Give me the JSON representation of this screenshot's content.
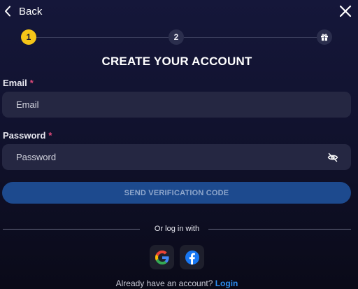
{
  "header": {
    "back_label": "Back"
  },
  "stepper": {
    "steps": [
      {
        "label": "1",
        "state": "active"
      },
      {
        "label": "2",
        "state": "inactive"
      },
      {
        "icon": "gift-icon",
        "state": "inactive"
      }
    ],
    "active_color": "#f5c518"
  },
  "form": {
    "title": "CREATE YOUR ACCOUNT",
    "email": {
      "label": "Email",
      "required_mark": "*",
      "placeholder": "Email",
      "value": ""
    },
    "password": {
      "label": "Password",
      "required_mark": "*",
      "placeholder": "Password",
      "value": "",
      "toggle_icon": "eye-off-icon"
    },
    "send_button_label": "SEND VERIFICATION CODE"
  },
  "social": {
    "divider_text": "Or log in with",
    "providers": [
      {
        "name": "Google",
        "icon": "google-icon"
      },
      {
        "name": "Facebook",
        "icon": "facebook-icon"
      }
    ]
  },
  "footer": {
    "prompt": "Already have an account?",
    "login_label": "Login",
    "link_color": "#2e8ef0"
  },
  "colors": {
    "background": "#15173a",
    "accent_button": "#1d4a8e",
    "required": "#e04a7a"
  }
}
